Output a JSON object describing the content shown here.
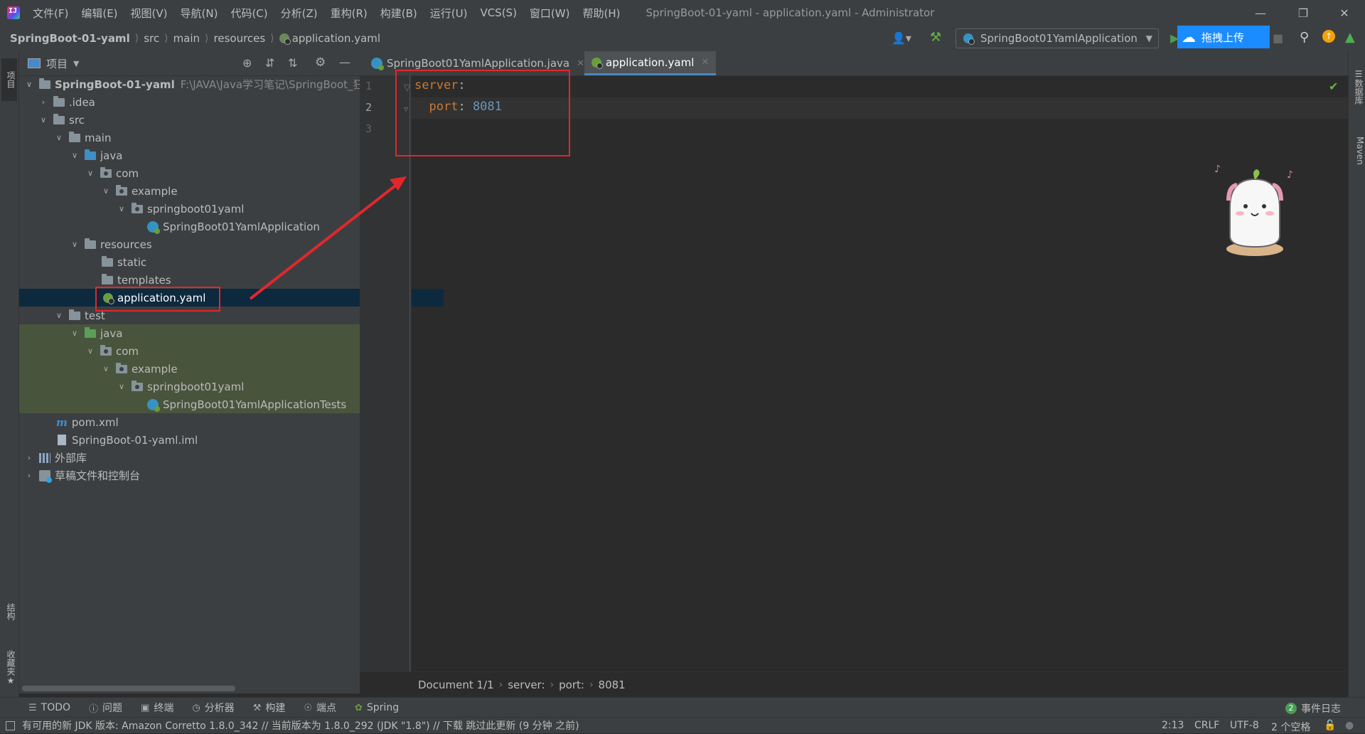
{
  "menu": [
    "文件(F)",
    "编辑(E)",
    "视图(V)",
    "导航(N)",
    "代码(C)",
    "分析(Z)",
    "重构(R)",
    "构建(B)",
    "运行(U)",
    "VCS(S)",
    "窗口(W)",
    "帮助(H)"
  ],
  "window_title": "SpringBoot-01-yaml - application.yaml - Administrator",
  "breadcrumbs": [
    "SpringBoot-01-yaml",
    "src",
    "main",
    "resources",
    "application.yaml"
  ],
  "run_config": "SpringBoot01YamlApplication",
  "upload_label": "拖拽上传",
  "left_stripe": {
    "project": "项目",
    "structure": "结构",
    "favorites": "收藏夹"
  },
  "right_stripe": {
    "database": "数据库",
    "maven": "Maven"
  },
  "project_panel": {
    "title": "项目",
    "tree": [
      {
        "label": "SpringBoot-01-yaml",
        "extra": "F:\\JAVA\\Java学习笔记\\SpringBoot_狂"
      },
      {
        "label": ".idea"
      },
      {
        "label": "src"
      },
      {
        "label": "main"
      },
      {
        "label": "java"
      },
      {
        "label": "com"
      },
      {
        "label": "example"
      },
      {
        "label": "springboot01yaml"
      },
      {
        "label": "SpringBoot01YamlApplication"
      },
      {
        "label": "resources"
      },
      {
        "label": "static"
      },
      {
        "label": "templates"
      },
      {
        "label": "application.yaml"
      },
      {
        "label": "test"
      },
      {
        "label": "java"
      },
      {
        "label": "com"
      },
      {
        "label": "example"
      },
      {
        "label": "springboot01yaml"
      },
      {
        "label": "SpringBoot01YamlApplicationTests"
      },
      {
        "label": "pom.xml"
      },
      {
        "label": "SpringBoot-01-yaml.iml"
      },
      {
        "label": "外部库"
      },
      {
        "label": "草稿文件和控制台"
      }
    ]
  },
  "tabs": [
    {
      "label": "SpringBoot01YamlApplication.java",
      "active": false
    },
    {
      "label": "application.yaml",
      "active": true
    }
  ],
  "editor": {
    "line_numbers": [
      "1",
      "2",
      "3"
    ],
    "lines": [
      {
        "key": "server",
        "colon": ":",
        "value": ""
      },
      {
        "key": "port",
        "colon": ":",
        "value": "8081"
      },
      {
        "key": "",
        "colon": "",
        "value": ""
      }
    ]
  },
  "editor_breadcrumb": [
    "Document 1/1",
    "server:",
    "port:",
    "8081"
  ],
  "tool_windows": [
    {
      "icon": "list-icon",
      "label": "TODO"
    },
    {
      "icon": "info-icon",
      "label": "问题"
    },
    {
      "icon": "terminal-icon",
      "label": "终端"
    },
    {
      "icon": "profiler-icon",
      "label": "分析器"
    },
    {
      "icon": "hammer-icon",
      "label": "构建"
    },
    {
      "icon": "endpoints-icon",
      "label": "端点"
    },
    {
      "icon": "spring-icon",
      "label": "Spring"
    }
  ],
  "event_log": {
    "count": "2",
    "label": "事件日志"
  },
  "status": {
    "message": "有可用的新 JDK 版本: Amazon Corretto 1.8.0_342 // 当前版本为 1.8.0_292 (JDK \"1.8\") // 下载   跳过此更新 (9 分钟 之前)",
    "position": "2:13",
    "line_sep": "CRLF",
    "encoding": "UTF-8",
    "indent": "2 个空格"
  },
  "colors": {
    "accent": "#4a88c7",
    "annotation": "#e0282c",
    "selection": "#0d293e",
    "test_bg": "#49543d"
  }
}
